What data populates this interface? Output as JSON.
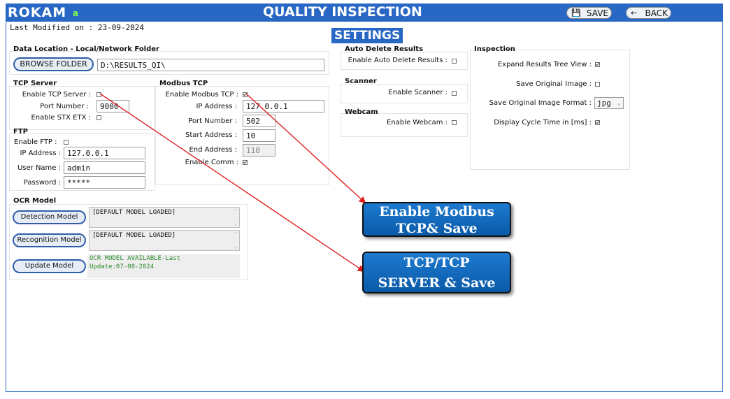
{
  "header": {
    "brand": "ROKAM",
    "version": "a",
    "title": "QUALITY INSPECTION",
    "save_label": "SAVE",
    "back_label": "BACK"
  },
  "last_modified": "Last Modified on : 23-09-2024",
  "page_heading": "SETTINGS",
  "data_location": {
    "title": "Data Location - Local/Network Folder",
    "browse_label": "BROWSE FOLDER",
    "path": "D:\\RESULTS_QI\\"
  },
  "tcp_server": {
    "title": "TCP Server",
    "enable_label": "Enable TCP Server :",
    "enable_checked": false,
    "port_label": "Port Number :",
    "port_value": "9000",
    "stx_label": "Enable STX ETX :",
    "stx_checked": false
  },
  "ftp": {
    "title": "FTP",
    "enable_label": "Enable FTP :",
    "enable_checked": false,
    "ip_label": "IP Address :",
    "ip_value": "127.0.0.1",
    "user_label": "User Name :",
    "user_value": "admin",
    "password_label": "Password :",
    "password_value": "*****"
  },
  "modbus": {
    "title": "Modbus TCP",
    "enable_label": "Enable Modbus TCP :",
    "enable_checked": true,
    "ip_label": "IP Address :",
    "ip_value": "127.0.0.1",
    "port_label": "Port Number :",
    "port_value": "502",
    "start_label": "Start Address :",
    "start_value": "10",
    "end_label": "End Address :",
    "end_value": "110",
    "comm_label": "Enable Comm :",
    "comm_checked": true
  },
  "ocr": {
    "title": "OCR Model",
    "detection_label": "Detection Model",
    "detection_text": "[DEFAULT MODEL LOADED]",
    "recognition_label": "Recognition Model",
    "recognition_text": "[DEFAULT MODEL LOADED]",
    "update_label": "Update Model",
    "status_line1": "OCR MODEL AVAILABLE-Last",
    "status_line2": "Update:07-08-2024"
  },
  "auto_delete": {
    "title": "Auto Delete Results",
    "enable_label": "Enable Auto Delete Results :",
    "enable_checked": false
  },
  "scanner": {
    "title": "Scanner",
    "enable_label": "Enable Scanner :",
    "enable_checked": false
  },
  "webcam": {
    "title": "Webcam",
    "enable_label": "Enable Webcam :",
    "enable_checked": false
  },
  "inspection": {
    "title": "Inspection",
    "tree_label": "Expand Results Tree View :",
    "tree_checked": true,
    "save_orig_label": "Save Original Image :",
    "save_orig_checked": false,
    "format_label": "Save Original Image Format :",
    "format_value": "jpg",
    "cycle_label": "Display Cycle Time in [ms] :",
    "cycle_checked": true
  },
  "callouts": {
    "modbus_line1": "Enable Modbus",
    "modbus_line2": "TCP& Save",
    "tcp_line1": "TCP/TCP",
    "tcp_line2": "SERVER & Save"
  },
  "colors": {
    "header_blue": "#2868c4",
    "callout_blue": "#0d63b8",
    "arrow_red": "#e02020",
    "status_green": "#2a8a2a"
  }
}
